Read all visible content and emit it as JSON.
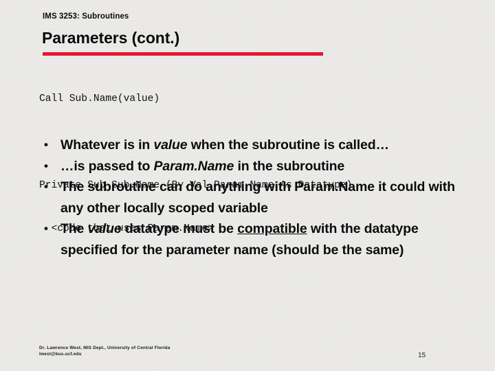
{
  "slide": {
    "eyebrow": "IMS 3253: Subroutines",
    "title": "Parameters (cont.)",
    "accent_color": "#e8152f",
    "background_color": "#f3f2f0",
    "text_color": "#0b0b0b"
  },
  "code": {
    "line1": "Call Sub.Name(value)",
    "line2": "Private Sub Sub.Name (By.Val Param.Name As Datatype)",
    "line3": "  <code that uses Param.Name>"
  },
  "bullets": [
    {
      "marker": "•",
      "parts": [
        {
          "text": "Whatever is in ",
          "style": "normal"
        },
        {
          "text": "value",
          "style": "italic"
        },
        {
          "text": " when the subroutine is called…",
          "style": "normal"
        }
      ],
      "plain": "Whatever is in value when the subroutine is called…"
    },
    {
      "marker": "•",
      "parts": [
        {
          "text": "…is passed to ",
          "style": "normal"
        },
        {
          "text": "Param.Name",
          "style": "italic"
        },
        {
          "text": " in the subroutine",
          "style": "normal"
        }
      ],
      "plain": "…is passed to Param.Name in the subroutine"
    },
    {
      "marker": "•",
      "parts": [
        {
          "text": "The subroutine can do anything with Param.Name it could with any other locally scoped variable",
          "style": "normal"
        }
      ],
      "plain": "The subroutine can do anything with Param.Name it could with any other locally scoped variable"
    },
    {
      "marker": "•",
      "parts": [
        {
          "text": "The ",
          "style": "normal"
        },
        {
          "text": "value",
          "style": "italic"
        },
        {
          "text": " datatype must be ",
          "style": "normal"
        },
        {
          "text": "compatible",
          "style": "underline"
        },
        {
          "text": " with the datatype specified for the parameter name (should be the same)",
          "style": "normal"
        }
      ],
      "plain": "The value datatype must be compatible with the datatype specified for the parameter name (should be the same)"
    }
  ],
  "footer": {
    "credit_line1": "Dr. Lawrence West, MIS Dept., University of Central Florida",
    "credit_line2": "lwest@bus.ucf.edu",
    "slide_number": "15"
  }
}
